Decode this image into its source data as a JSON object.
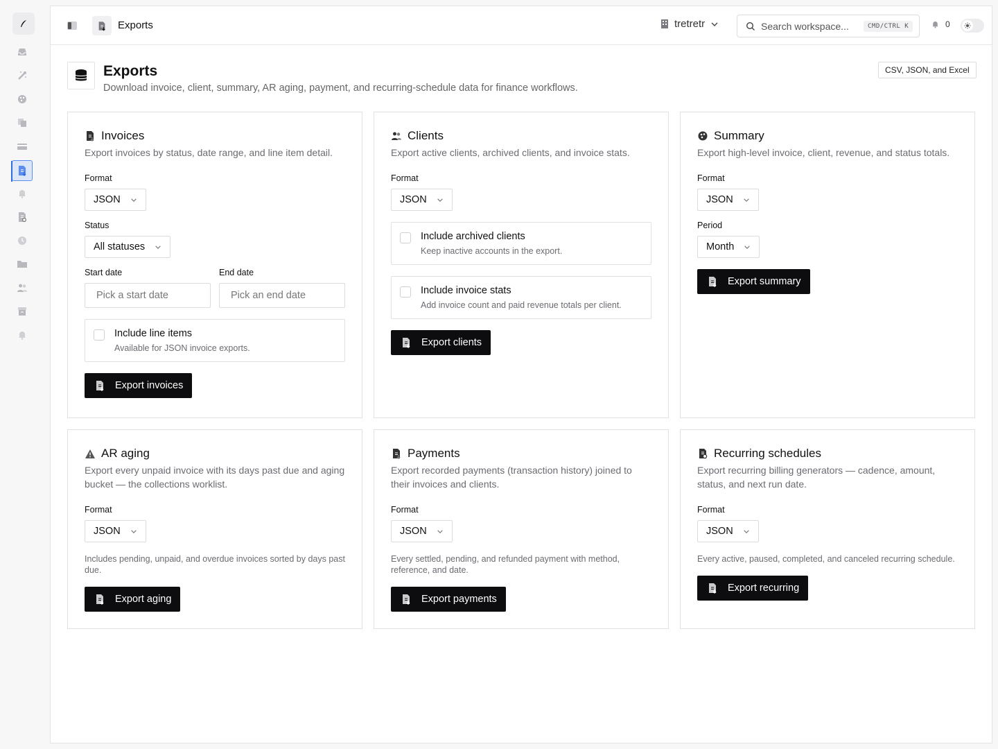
{
  "app": {
    "title": "Exports"
  },
  "sidebar": {
    "items": [
      {
        "icon": "inbox-icon"
      },
      {
        "icon": "wand-icon"
      },
      {
        "icon": "palette-icon"
      },
      {
        "icon": "copy-icon"
      },
      {
        "icon": "credit-card-icon"
      },
      {
        "icon": "file-export-icon",
        "active": true
      },
      {
        "icon": "bell-icon"
      },
      {
        "icon": "file-refresh-icon"
      },
      {
        "icon": "clock-icon"
      },
      {
        "icon": "folder-icon"
      },
      {
        "icon": "users-icon"
      },
      {
        "icon": "archive-icon"
      },
      {
        "icon": "bell-icon"
      }
    ]
  },
  "topbar": {
    "breadcrumb": "Exports",
    "workspace": "tretretr",
    "search_placeholder": "Search workspace...",
    "shortcut": "CMD/CTRL K",
    "notifications_count": "0"
  },
  "page": {
    "title": "Exports",
    "subtitle": "Download invoice, client, summary, AR aging, payment, and recurring-schedule data for finance workflows.",
    "formats_badge": "CSV, JSON, and Excel"
  },
  "cards": {
    "invoices": {
      "title": "Invoices",
      "desc": "Export invoices by status, date range, and line item detail.",
      "format_label": "Format",
      "format_value": "JSON",
      "status_label": "Status",
      "status_value": "All statuses",
      "start_label": "Start date",
      "start_placeholder": "Pick a start date",
      "end_label": "End date",
      "end_placeholder": "Pick an end date",
      "line_items_title": "Include line items",
      "line_items_sub": "Available for JSON invoice exports.",
      "button": "Export invoices"
    },
    "clients": {
      "title": "Clients",
      "desc": "Export active clients, archived clients, and invoice stats.",
      "format_label": "Format",
      "format_value": "JSON",
      "archived_title": "Include archived clients",
      "archived_sub": "Keep inactive accounts in the export.",
      "stats_title": "Include invoice stats",
      "stats_sub": "Add invoice count and paid revenue totals per client.",
      "button": "Export clients"
    },
    "summary": {
      "title": "Summary",
      "desc": "Export high-level invoice, client, revenue, and status totals.",
      "format_label": "Format",
      "format_value": "JSON",
      "period_label": "Period",
      "period_value": "Month",
      "button": "Export summary"
    },
    "aging": {
      "title": "AR aging",
      "desc": "Export every unpaid invoice with its days past due and aging bucket — the collections worklist.",
      "format_label": "Format",
      "format_value": "JSON",
      "note": "Includes pending, unpaid, and overdue invoices sorted by days past due.",
      "button": "Export aging"
    },
    "payments": {
      "title": "Payments",
      "desc": "Export recorded payments (transaction history) joined to their invoices and clients.",
      "format_label": "Format",
      "format_value": "JSON",
      "note": "Every settled, pending, and refunded payment with method, reference, and date.",
      "button": "Export payments"
    },
    "recurring": {
      "title": "Recurring schedules",
      "desc": "Export recurring billing generators — cadence, amount, status, and next run date.",
      "format_label": "Format",
      "format_value": "JSON",
      "note": "Every active, paused, completed, and canceled recurring schedule.",
      "button": "Export recurring"
    }
  }
}
